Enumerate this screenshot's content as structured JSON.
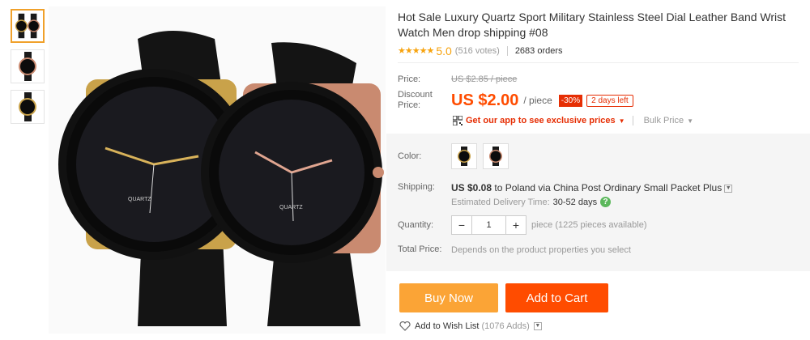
{
  "product": {
    "title": "Hot Sale Luxury Quartz Sport Military Stainless Steel Dial Leather Band Wrist Watch Men drop shipping #08",
    "stars": "★★★★★",
    "rating": "5.0",
    "votes": "(516 votes)",
    "orders": "2683 orders"
  },
  "pricing": {
    "price_label": "Price:",
    "old_price": "US $2.85 / piece",
    "discount_label": "Discount Price:",
    "now_price": "US $2.00",
    "per_piece": "/ piece",
    "off": "-30%",
    "days_left": "2 days left",
    "app_promo": "Get our app to see exclusive prices",
    "bulk": "Bulk Price"
  },
  "options": {
    "color_label": "Color:",
    "colors": [
      "gold",
      "rose-gold"
    ],
    "shipping_label": "Shipping:",
    "shipping_amount": "US $0.08",
    "shipping_dest": "to Poland via China Post Ordinary Small Packet Plus",
    "estimated_label": "Estimated Delivery Time:",
    "estimated_days": "30-52 days",
    "quantity_label": "Quantity:",
    "quantity": "1",
    "minus": "−",
    "plus": "+",
    "available": "piece (1225 pieces available)",
    "total_label": "Total Price:",
    "total_value": "Depends on the product properties you select"
  },
  "actions": {
    "buy_now": "Buy Now",
    "add_to_cart": "Add to Cart",
    "wish_label": "Add to Wish List",
    "wish_count": "(1076 Adds)"
  },
  "colors": {
    "accent_orange": "#ff4c00",
    "buy_orange": "#fba436",
    "star": "#f7a30e",
    "badge_red": "#e62e04"
  }
}
